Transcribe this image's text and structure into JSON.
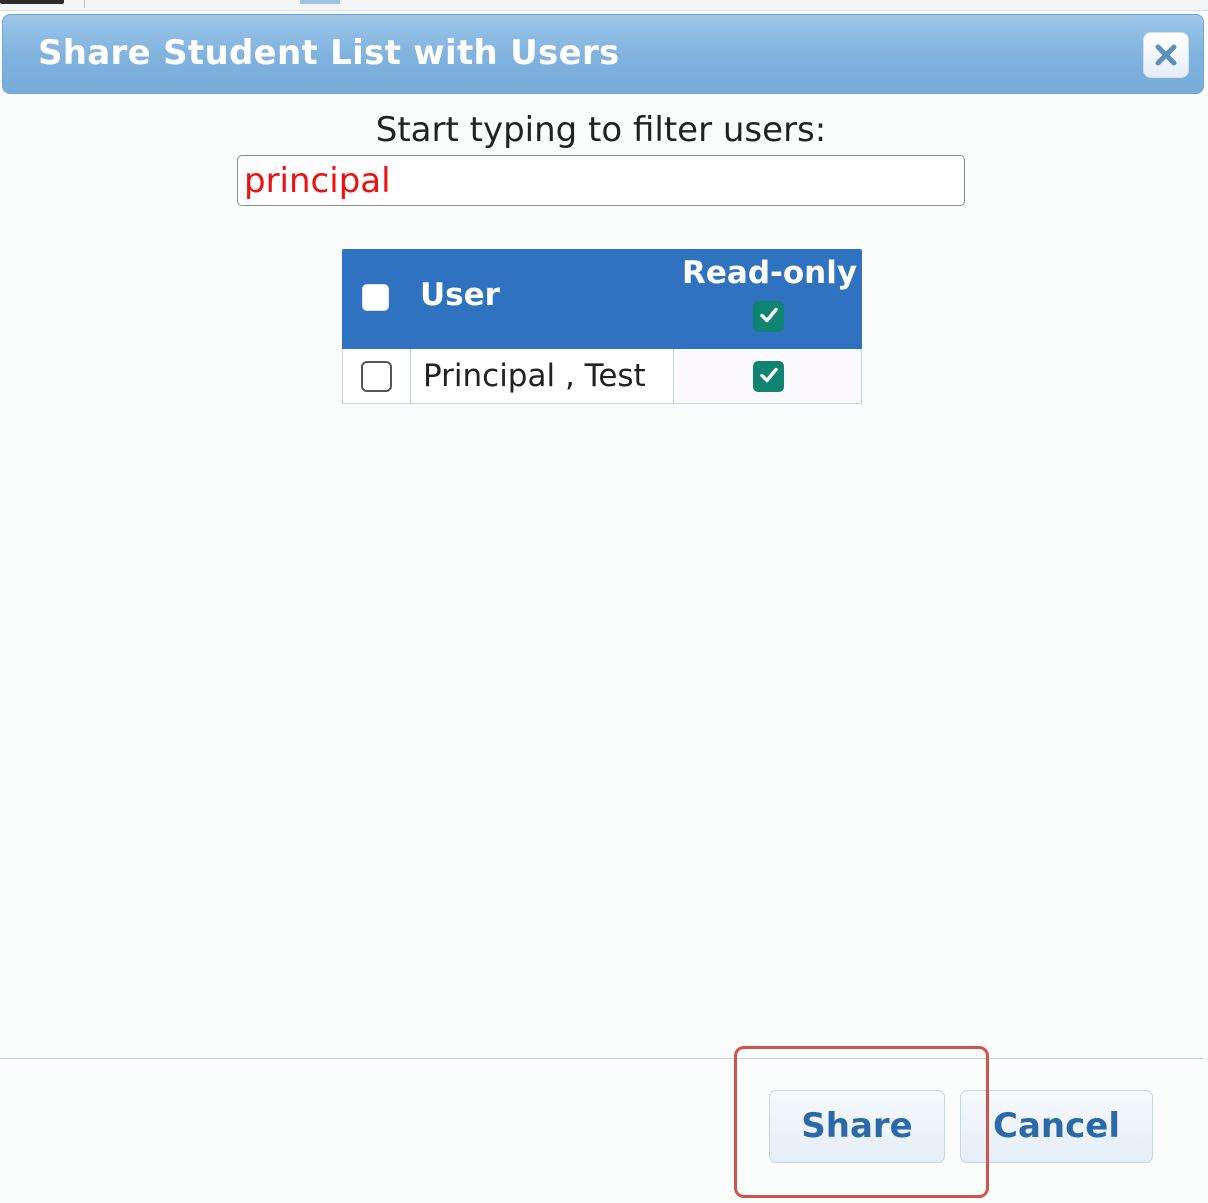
{
  "dialog": {
    "title": "Share Student List with Users",
    "close_icon": "close-icon"
  },
  "filter": {
    "label": "Start typing to filter users:",
    "value": "principal",
    "value_color": "#ee1111"
  },
  "table": {
    "header": {
      "select_all_checked": false,
      "user_label": "User",
      "readonly_label": "Read-only",
      "readonly_all_checked": true
    },
    "rows": [
      {
        "name": "Principal , Test",
        "selected": false,
        "readonly": true
      }
    ]
  },
  "footer": {
    "share_label": "Share",
    "cancel_label": "Cancel"
  },
  "colors": {
    "titlebar": "#7fb2de",
    "table_header": "#2f72bf",
    "check_green": "#0f8473",
    "button_text": "#2c6aa7",
    "highlight": "#d1544a"
  }
}
